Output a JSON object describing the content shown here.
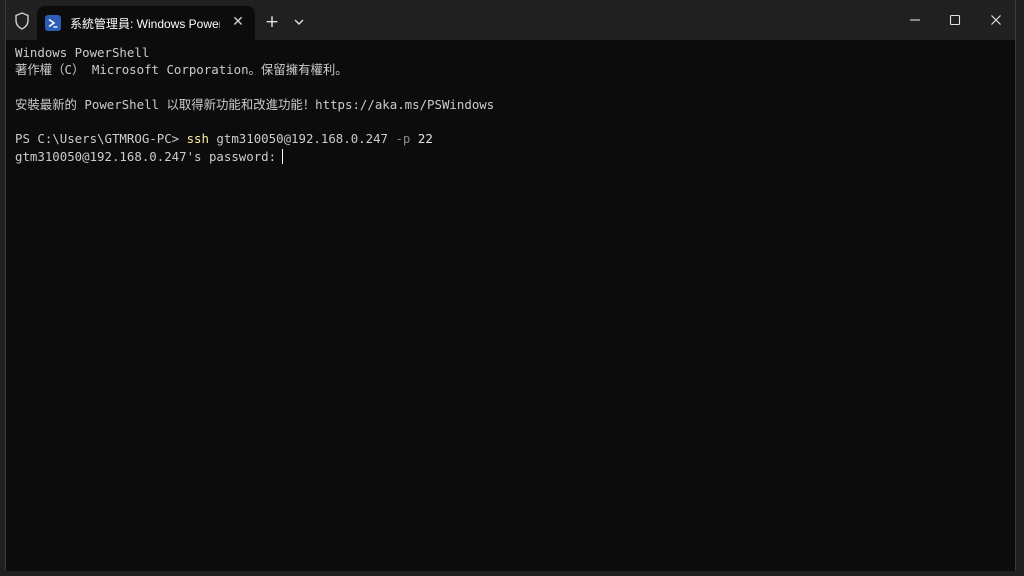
{
  "window": {
    "tab_title": "系統管理員: Windows PowerS",
    "tab_icon": "powershell-icon",
    "shield_icon": "shield-icon"
  },
  "terminal": {
    "lines": [
      "Windows PowerShell",
      "著作權（C） Microsoft Corporation。保留擁有權利。",
      "",
      "安裝最新的 PowerShell 以取得新功能和改進功能！https://aka.ms/PSWindows",
      ""
    ],
    "prompt": "PS C:\\Users\\GTMROG-PC> ",
    "command": "ssh",
    "command_arg": " gtm310050@192.168.0.247",
    "command_flag": " -p",
    "command_port": " 22",
    "password_prompt": "gtm310050@192.168.0.247's password:"
  },
  "colors": {
    "terminal_bg": "#0c0c0c",
    "titlebar_bg": "#202020",
    "text": "#cccccc",
    "command": "#f9f1a5",
    "flag": "#8a8a8a"
  }
}
